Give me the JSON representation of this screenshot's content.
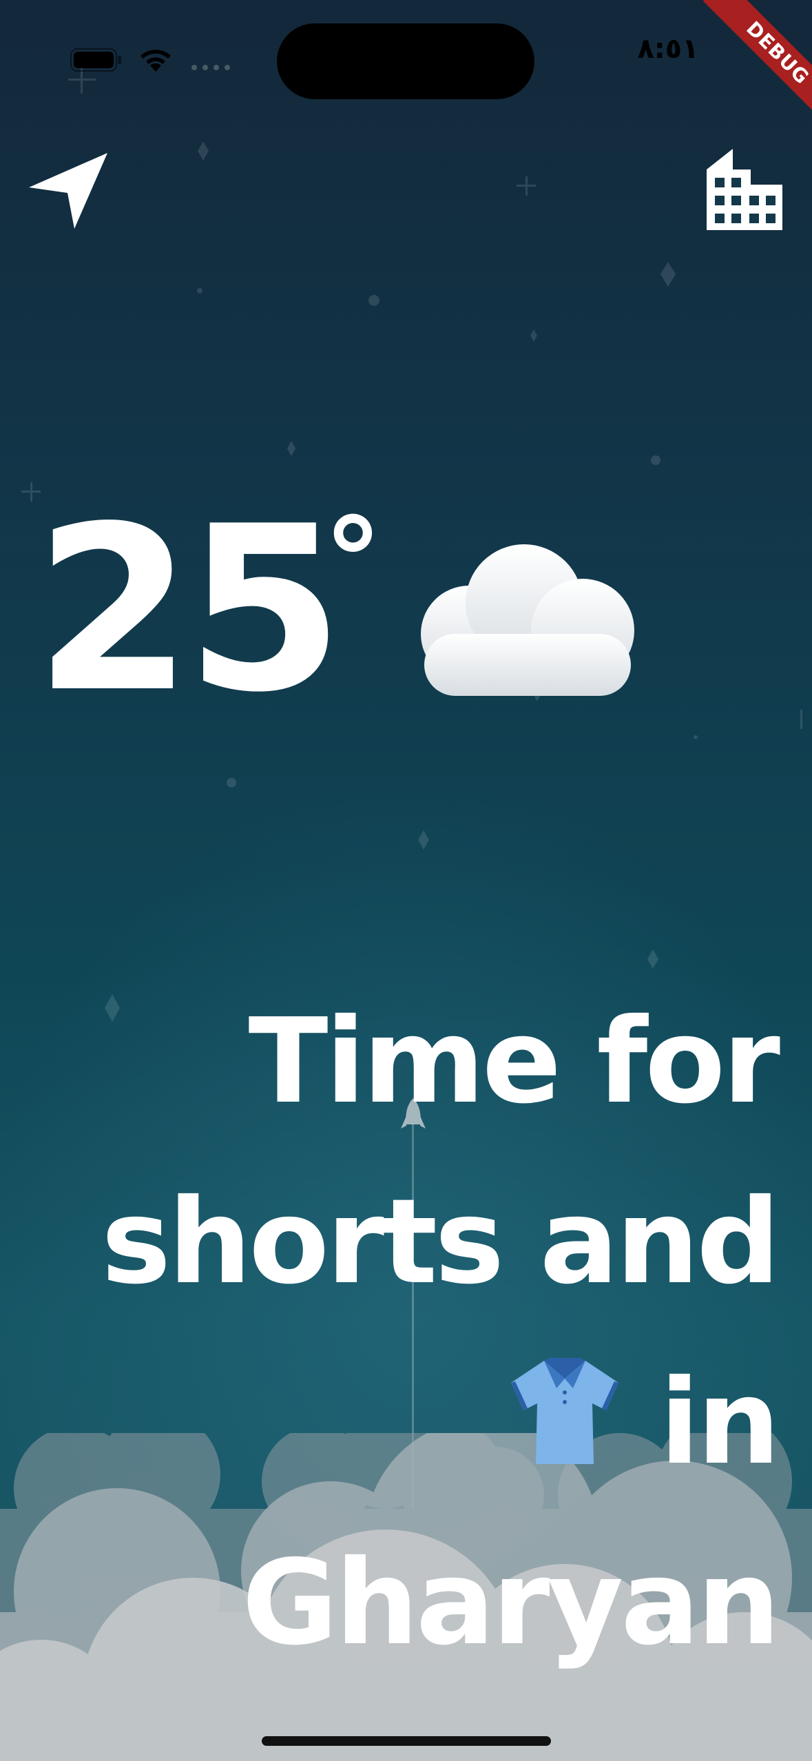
{
  "status_bar": {
    "time": "٨:٥١",
    "battery_icon": "battery-icon",
    "wifi_icon": "wifi-icon",
    "signal_icon": "signal-dots-icon"
  },
  "debug_banner": {
    "label": "DEBUG",
    "color": "#a8201f"
  },
  "nav": {
    "location_icon": "location-arrow-icon",
    "city_icon": "city-building-icon"
  },
  "weather": {
    "temperature": "25",
    "degree_symbol": "°",
    "condition_icon": "cloud-icon"
  },
  "headline": {
    "line1": "Time for",
    "line2": "shorts and",
    "line3_suffix": "in",
    "line3_icon": "polo-shirt-icon",
    "line4": "Gharyan"
  },
  "colors": {
    "background_top": "#13283a",
    "background_bottom": "#1a5664",
    "text": "#ffffff",
    "cloud": "#bfc3c6"
  }
}
